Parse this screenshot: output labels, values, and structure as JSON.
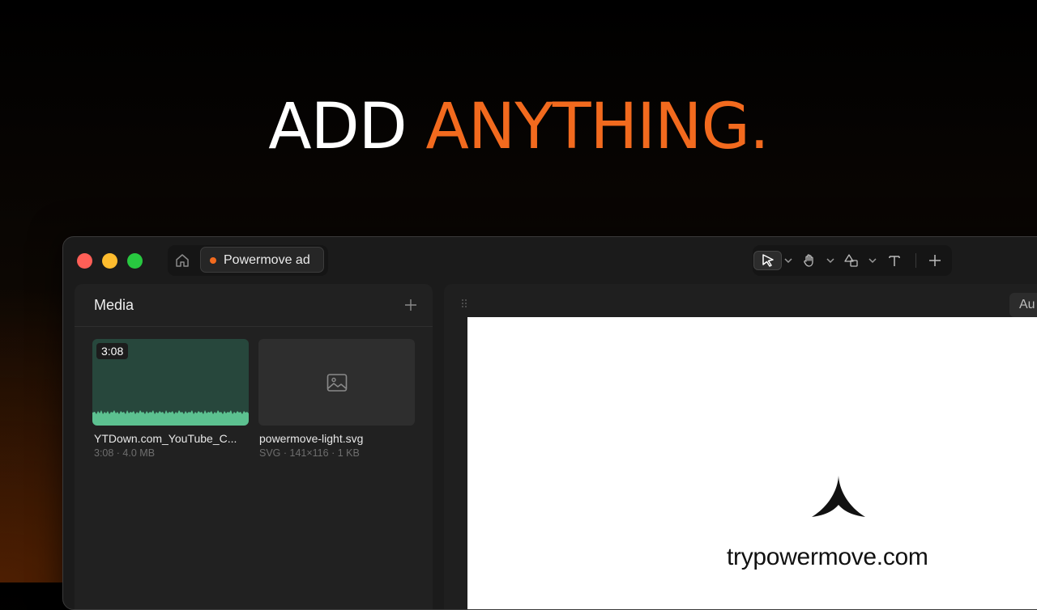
{
  "headline": {
    "word1": "ADD",
    "word2": "ANYTHING."
  },
  "colors": {
    "accent": "#f26a1e",
    "waveform": "#5cc190",
    "window_bg": "#1b1b1b"
  },
  "window": {
    "tab": {
      "label": "Powermove ad",
      "status": "unsaved-dot"
    },
    "toolbar": {
      "tools": [
        "select-pointer-icon",
        "hand-icon",
        "shapes-icon",
        "text-icon",
        "add-icon"
      ],
      "active_tool": "select-pointer-icon"
    },
    "media_panel": {
      "title": "Media",
      "items": [
        {
          "type": "video",
          "duration": "3:08",
          "name": "YTDown.com_YouTube_C...",
          "meta": "3:08 · 4.0 MB"
        },
        {
          "type": "image",
          "name": "powermove-light.svg",
          "meta": "SVG · 141×116 · 1 KB"
        }
      ]
    },
    "canvas": {
      "auto_button": "Au",
      "artboard_text": "trypowermove.com"
    }
  }
}
